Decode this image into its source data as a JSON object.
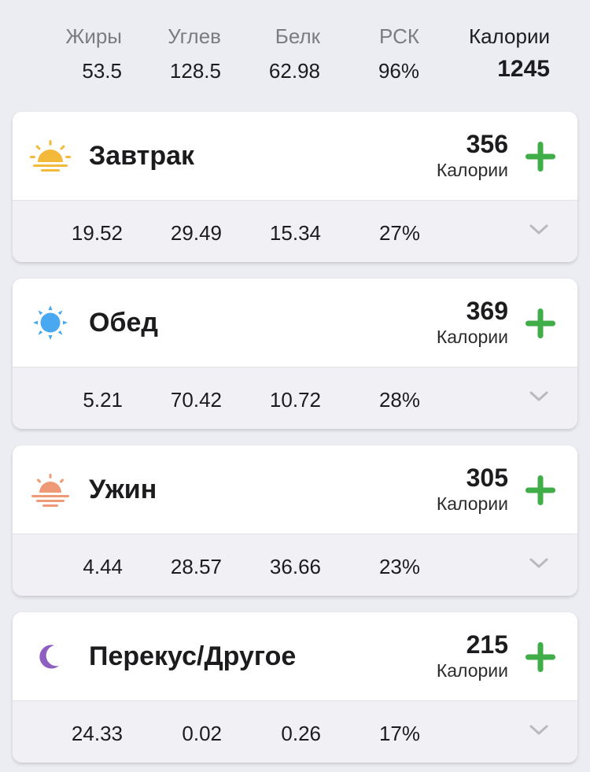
{
  "summary": {
    "fat_label": "Жиры",
    "fat_value": "53.5",
    "carbs_label": "Углев",
    "carbs_value": "128.5",
    "protein_label": "Белк",
    "protein_value": "62.98",
    "rsk_label": "РСК",
    "rsk_value": "96%",
    "calories_label": "Калории",
    "calories_value": "1245"
  },
  "meals": [
    {
      "icon": "sunrise-icon",
      "title": "Завтрак",
      "calories": "356",
      "calories_label": "Калории",
      "fat": "19.52",
      "carbs": "29.49",
      "protein": "15.34",
      "rsk": "27%"
    },
    {
      "icon": "sun-icon",
      "title": "Обед",
      "calories": "369",
      "calories_label": "Калории",
      "fat": "5.21",
      "carbs": "70.42",
      "protein": "10.72",
      "rsk": "28%"
    },
    {
      "icon": "sunset-icon",
      "title": "Ужин",
      "calories": "305",
      "calories_label": "Калории",
      "fat": "4.44",
      "carbs": "28.57",
      "protein": "36.66",
      "rsk": "23%"
    },
    {
      "icon": "moon-icon",
      "title": "Перекус/Другое",
      "calories": "215",
      "calories_label": "Калории",
      "fat": "24.33",
      "carbs": "0.02",
      "protein": "0.26",
      "rsk": "17%"
    }
  ],
  "colors": {
    "accent_green": "#3fae49",
    "sunrise": "#f3b93b",
    "sun": "#4aa8f0",
    "sunset": "#ef9a76",
    "moon": "#8e5fc0"
  }
}
